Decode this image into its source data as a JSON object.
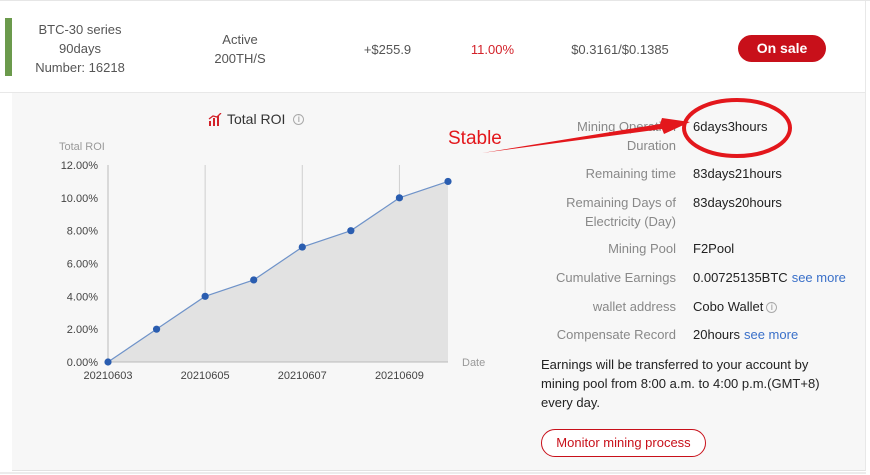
{
  "row": {
    "series_line1": "BTC-30 series",
    "series_line2": "90days",
    "series_line3": "Number: 16218",
    "status_line1": "Active",
    "status_line2": "200TH/S",
    "profit": "+$255.9",
    "roi": "11.00%",
    "price": "$0.3161/$0.1385",
    "sale_label": "On sale"
  },
  "chart_title": "Total ROI",
  "info": {
    "op_label_1": "Mining Operation",
    "op_label_2": "Duration",
    "op_value": "6days3hours",
    "remaining_label": "Remaining time",
    "remaining_value": "83days21hours",
    "elec_label_1": "Remaining Days of",
    "elec_label_2": "Electricity (Day)",
    "elec_value": "83days20hours",
    "pool_label": "Mining Pool",
    "pool_value": "F2Pool",
    "earnings_label": "Cumulative Earnings",
    "earnings_value": "0.00725135BTC",
    "earnings_more": "see more",
    "wallet_label": "wallet address",
    "wallet_value": "Cobo Wallet",
    "comp_label": "Compensate Record",
    "comp_value": "20hours",
    "comp_more": "see more"
  },
  "notice": "Earnings will be transferred to your account by mining pool from 8:00 a.m. to 4:00 p.m.(GMT+8) every day.",
  "monitor_label": "Monitor mining process",
  "annotation": "Stable",
  "colors": {
    "accent_green": "#6b9a4c",
    "brand_red": "#c8101a",
    "link_blue": "#3a70c9",
    "line_blue": "#2a5db0"
  },
  "chart_data": {
    "type": "area",
    "title": "Total ROI",
    "ylabel": "Total ROI",
    "xlabel": "Date",
    "x": [
      "20210603",
      "20210604",
      "20210605",
      "20210606",
      "20210607",
      "20210608",
      "20210609",
      "20210610"
    ],
    "x_tick_labels": [
      "20210603",
      "20210605",
      "20210607",
      "20210609"
    ],
    "y_tick_labels": [
      "0.00%",
      "2.00%",
      "4.00%",
      "6.00%",
      "8.00%",
      "10.00%",
      "12.00%"
    ],
    "values": [
      0,
      2,
      4,
      5,
      7,
      8,
      10,
      11
    ],
    "ylim": [
      0,
      12
    ],
    "grid": "vertical"
  }
}
